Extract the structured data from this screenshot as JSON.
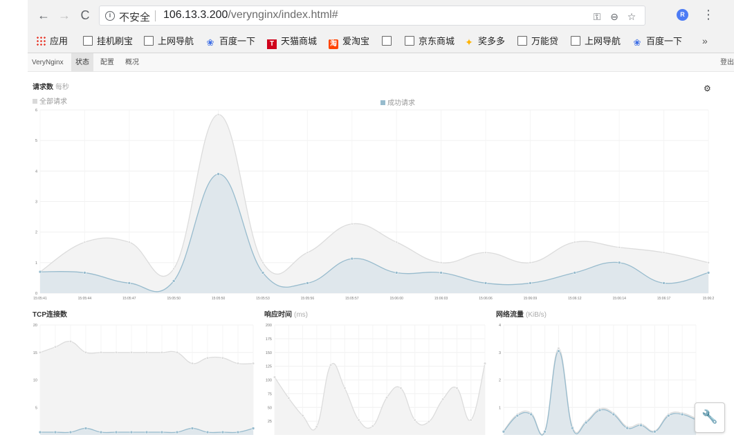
{
  "browser": {
    "insecure_label": "不安全",
    "url_host": "106.13.3.200",
    "url_path": "/verynginx/index.html#",
    "extension_label": "R",
    "bookmarks": [
      {
        "label": "应用",
        "icon": "apps-icon"
      },
      {
        "label": "挂机刷宝",
        "icon": "page-icon"
      },
      {
        "label": "上网导航",
        "icon": "page-icon"
      },
      {
        "label": "百度一下",
        "icon": "paw-icon"
      },
      {
        "label": "天猫商城",
        "icon": "tmall-icon"
      },
      {
        "label": "爱淘宝",
        "icon": "taobao-icon"
      },
      {
        "label": "",
        "icon": "page-icon"
      },
      {
        "label": "京东商城",
        "icon": "page-icon"
      },
      {
        "label": "奖多多",
        "icon": "star-icon"
      },
      {
        "label": "万能贷",
        "icon": "page-icon"
      },
      {
        "label": "上网导航",
        "icon": "page-icon"
      },
      {
        "label": "百度一下",
        "icon": "paw-icon"
      }
    ],
    "more_label": "»"
  },
  "nav": {
    "brand": "VeryNginx",
    "items": [
      "状态",
      "配置",
      "概况"
    ],
    "logout": "登出"
  },
  "colors": {
    "all_fill": "#f3f3f3",
    "all_line": "#dcdcdc",
    "success_fill": "#dfe7ec",
    "success_line": "#97bbcd"
  },
  "requests_panel": {
    "title": "请求数",
    "unit": "每秒",
    "legend_all": "全部请求",
    "legend_success": "成功请求"
  },
  "tcp_panel": {
    "title": "TCP连接数"
  },
  "response_panel": {
    "title": "响应时间",
    "unit": "(ms)"
  },
  "traffic_panel": {
    "title": "网络流量",
    "unit": "(KiB/s)"
  },
  "chart_data": [
    {
      "type": "area",
      "title": "请求数 每秒",
      "x": [
        "15:05:41",
        "15:05:44",
        "15:05:47",
        "15:05:50",
        "15:05:50",
        "15:05:53",
        "15:05:56",
        "15:05:57",
        "15:06:00",
        "15:06:03",
        "15:06:06",
        "15:06:09",
        "15:06:12",
        "15:06:14",
        "15:06:17",
        "15:06:2"
      ],
      "ylim": [
        0,
        6
      ],
      "yticks": [
        0,
        1,
        2,
        3,
        4,
        5,
        6
      ],
      "grid": true,
      "legend": "top",
      "series": [
        {
          "name": "全部请求",
          "values": [
            0.7,
            1.67,
            1.67,
            0.8,
            5.85,
            1.0,
            1.33,
            2.27,
            1.67,
            1.0,
            1.33,
            1.0,
            1.67,
            1.5,
            1.33,
            1.0
          ]
        },
        {
          "name": "成功请求",
          "values": [
            0.7,
            0.67,
            0.33,
            0.4,
            3.9,
            0.67,
            0.33,
            1.13,
            0.67,
            0.67,
            0.33,
            0.33,
            0.67,
            1.0,
            0.33,
            0.67
          ]
        }
      ]
    },
    {
      "type": "line",
      "title": "TCP连接数",
      "ylim": [
        0,
        20
      ],
      "yticks": [
        5,
        10,
        15,
        20
      ],
      "grid": true,
      "series": [
        {
          "values": [
            15,
            16,
            17,
            15,
            15,
            15,
            15,
            15,
            15,
            15,
            13,
            14,
            14,
            13,
            13
          ]
        },
        {
          "values": [
            0.5,
            0.5,
            0.5,
            1.2,
            0.5,
            0.5,
            0.5,
            0.5,
            0.5,
            0.5,
            1.2,
            0.5,
            0.5,
            0.5,
            1.2
          ]
        }
      ]
    },
    {
      "type": "line",
      "title": "响应时间 (ms)",
      "ylim": [
        0,
        200
      ],
      "yticks": [
        25,
        50,
        75,
        100,
        125,
        150,
        175,
        200
      ],
      "grid": true,
      "series": [
        {
          "values": [
            105,
            67,
            35,
            15,
            127,
            85,
            27,
            16,
            68,
            85,
            27,
            24,
            65,
            85,
            27,
            130
          ]
        }
      ]
    },
    {
      "type": "area",
      "title": "网络流量 (KiB/s)",
      "ylim": [
        0,
        4
      ],
      "yticks": [
        1,
        2,
        3,
        4
      ],
      "grid": true,
      "series": [
        {
          "values": [
            0.15,
            0.75,
            0.8,
            0.15,
            3.15,
            0.3,
            0.5,
            0.95,
            0.8,
            0.3,
            0.4,
            0.15,
            0.75,
            0.8,
            0.6
          ]
        },
        {
          "values": [
            0.12,
            0.7,
            0.75,
            0.12,
            3.05,
            0.25,
            0.45,
            0.9,
            0.75,
            0.25,
            0.35,
            0.12,
            0.7,
            0.75,
            0.55
          ]
        }
      ]
    }
  ]
}
